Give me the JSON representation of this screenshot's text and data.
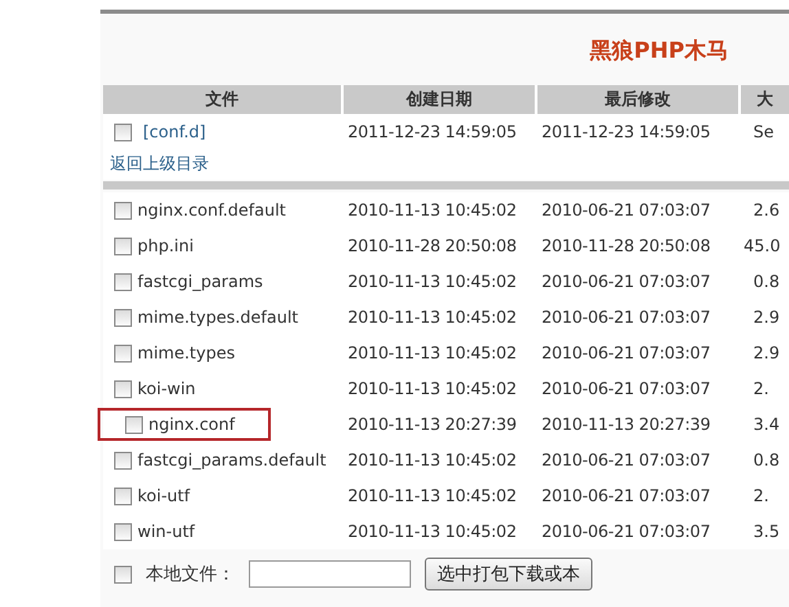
{
  "title": "黑狼PHP木马",
  "columns": [
    "文件",
    "创建日期",
    "最后修改",
    "大"
  ],
  "folder": {
    "name": "[conf.d]",
    "created": "2011-12-23 14:59:05",
    "modified": "2011-12-23 14:59:05",
    "size": "Se",
    "checked": false
  },
  "parent_link": "返回上级目录",
  "files": [
    {
      "name": "nginx.conf.default",
      "created": "2010-11-13 10:45:02",
      "modified": "2010-06-21 07:03:07",
      "size": "2.6",
      "checked": false,
      "highlighted": false
    },
    {
      "name": "php.ini",
      "created": "2010-11-28 20:50:08",
      "modified": "2010-11-28 20:50:08",
      "size": "45.0",
      "checked": false,
      "highlighted": false
    },
    {
      "name": "fastcgi_params",
      "created": "2010-11-13 10:45:02",
      "modified": "2010-06-21 07:03:07",
      "size": "0.8",
      "checked": false,
      "highlighted": false
    },
    {
      "name": "mime.types.default",
      "created": "2010-11-13 10:45:02",
      "modified": "2010-06-21 07:03:07",
      "size": "2.9",
      "checked": false,
      "highlighted": false
    },
    {
      "name": "mime.types",
      "created": "2010-11-13 10:45:02",
      "modified": "2010-06-21 07:03:07",
      "size": "2.9",
      "checked": false,
      "highlighted": false
    },
    {
      "name": "koi-win",
      "created": "2010-11-13 10:45:02",
      "modified": "2010-06-21 07:03:07",
      "size": "2.",
      "checked": false,
      "highlighted": false
    },
    {
      "name": "nginx.conf",
      "created": "2010-11-13 20:27:39",
      "modified": "2010-11-13 20:27:39",
      "size": "3.4",
      "checked": false,
      "highlighted": true
    },
    {
      "name": "fastcgi_params.default",
      "created": "2010-11-13 10:45:02",
      "modified": "2010-06-21 07:03:07",
      "size": "0.8",
      "checked": false,
      "highlighted": false
    },
    {
      "name": "koi-utf",
      "created": "2010-11-13 10:45:02",
      "modified": "2010-06-21 07:03:07",
      "size": "2.",
      "checked": false,
      "highlighted": false
    },
    {
      "name": "win-utf",
      "created": "2010-11-13 10:45:02",
      "modified": "2010-06-21 07:03:07",
      "size": "3.5",
      "checked": false,
      "highlighted": false
    }
  ],
  "footer": {
    "checked": false,
    "label": "本地文件：",
    "button": "选中打包下载或本"
  }
}
